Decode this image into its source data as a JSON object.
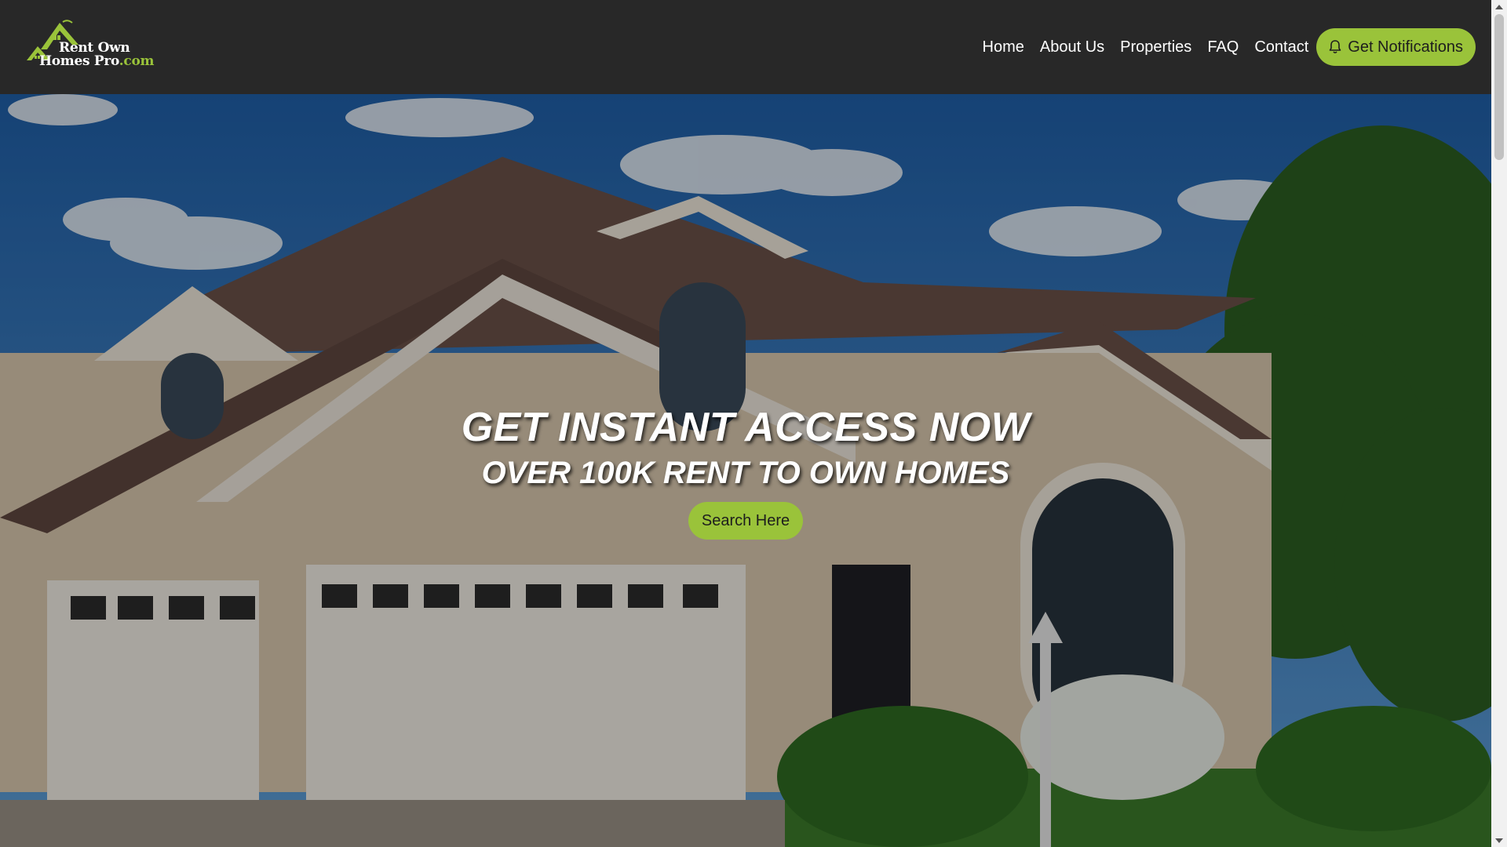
{
  "logo": {
    "line1": "Rent Own",
    "line2": "Homes Pro",
    "suffix": ".com",
    "accent_color": "#9ac33a"
  },
  "nav": {
    "items": [
      {
        "label": "Home"
      },
      {
        "label": "About Us"
      },
      {
        "label": "Properties"
      },
      {
        "label": "FAQ"
      },
      {
        "label": "Contact"
      }
    ],
    "notify_button": {
      "label": "Get Notifications",
      "icon": "bell-icon"
    }
  },
  "hero": {
    "title": "GET INSTANT ACCESS NOW",
    "subtitle": "OVER 100K RENT TO OWN HOMES",
    "search_button": "Search Here"
  },
  "colors": {
    "header_bg": "#282828",
    "accent": "#9ac33a"
  }
}
